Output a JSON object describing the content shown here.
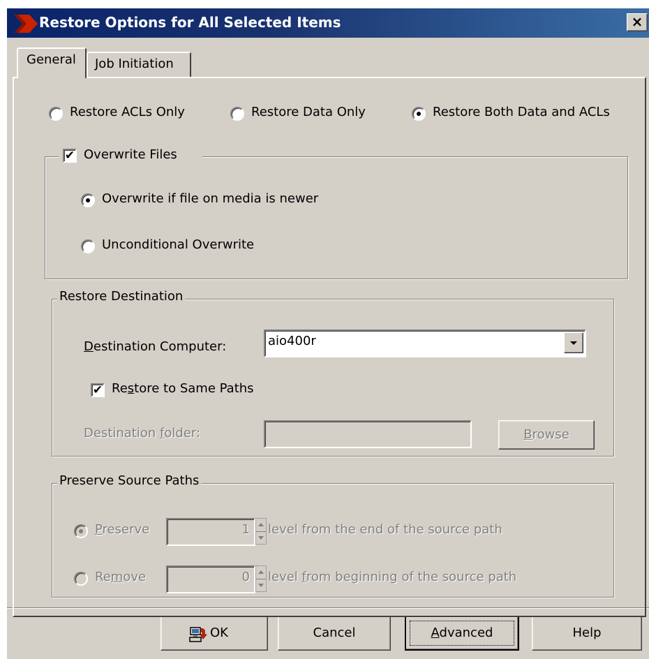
{
  "window": {
    "title": "Restore Options for All Selected Items",
    "close_glyph": "×"
  },
  "tabs": [
    {
      "label": "General",
      "active": true
    },
    {
      "label": "Job Initiation",
      "active": false
    }
  ],
  "restore_type": {
    "options": [
      {
        "label": "Restore ACLs Only",
        "checked": false
      },
      {
        "label": "Restore Data Only",
        "checked": false
      },
      {
        "label": "Restore Both Data and ACLs",
        "checked": true
      }
    ]
  },
  "overwrite": {
    "label": "Overwrite Files",
    "checked": true,
    "check_glyph": "✔",
    "options": [
      {
        "label": "Overwrite if file on media is newer",
        "checked": true
      },
      {
        "label": "Unconditional Overwrite",
        "checked": false
      }
    ]
  },
  "destination": {
    "group_title": "Restore Destination",
    "computer_label_accel": "D",
    "computer_label_rest": "estination Computer:",
    "computer_value": "aio400r",
    "same_paths_label_pre": "Re",
    "same_paths_label_accel": "s",
    "same_paths_label_post": "tore to Same Paths",
    "same_paths_checked": true,
    "folder_label_pre": "Destination ",
    "folder_label_accel": "f",
    "folder_label_post": "older:",
    "folder_value": "",
    "browse_accel": "B",
    "browse_rest": "rowse"
  },
  "preserve": {
    "group_title": "Preserve Source Paths",
    "preserve_accel": "P",
    "preserve_rest": "reserve",
    "preserve_value": "1",
    "preserve_suffix": "level from the end of the source path",
    "remove_pre": "Re",
    "remove_accel": "m",
    "remove_post": "ove",
    "remove_value": "0",
    "remove_suffix_pre": "level ",
    "remove_suffix_accel": "f",
    "remove_suffix_post": "rom beginning of the source path"
  },
  "buttons": {
    "ok": "OK",
    "cancel": "Cancel",
    "advanced_accel": "A",
    "advanced_rest": "dvanced",
    "help": "Help"
  },
  "icons": {
    "logo": "commvault-logo-icon",
    "ok": "computer-restore-icon"
  },
  "colors": {
    "title_bar": "#0a246a",
    "dialog_face": "#d4d0c8",
    "logo_red": "#cc2200"
  }
}
